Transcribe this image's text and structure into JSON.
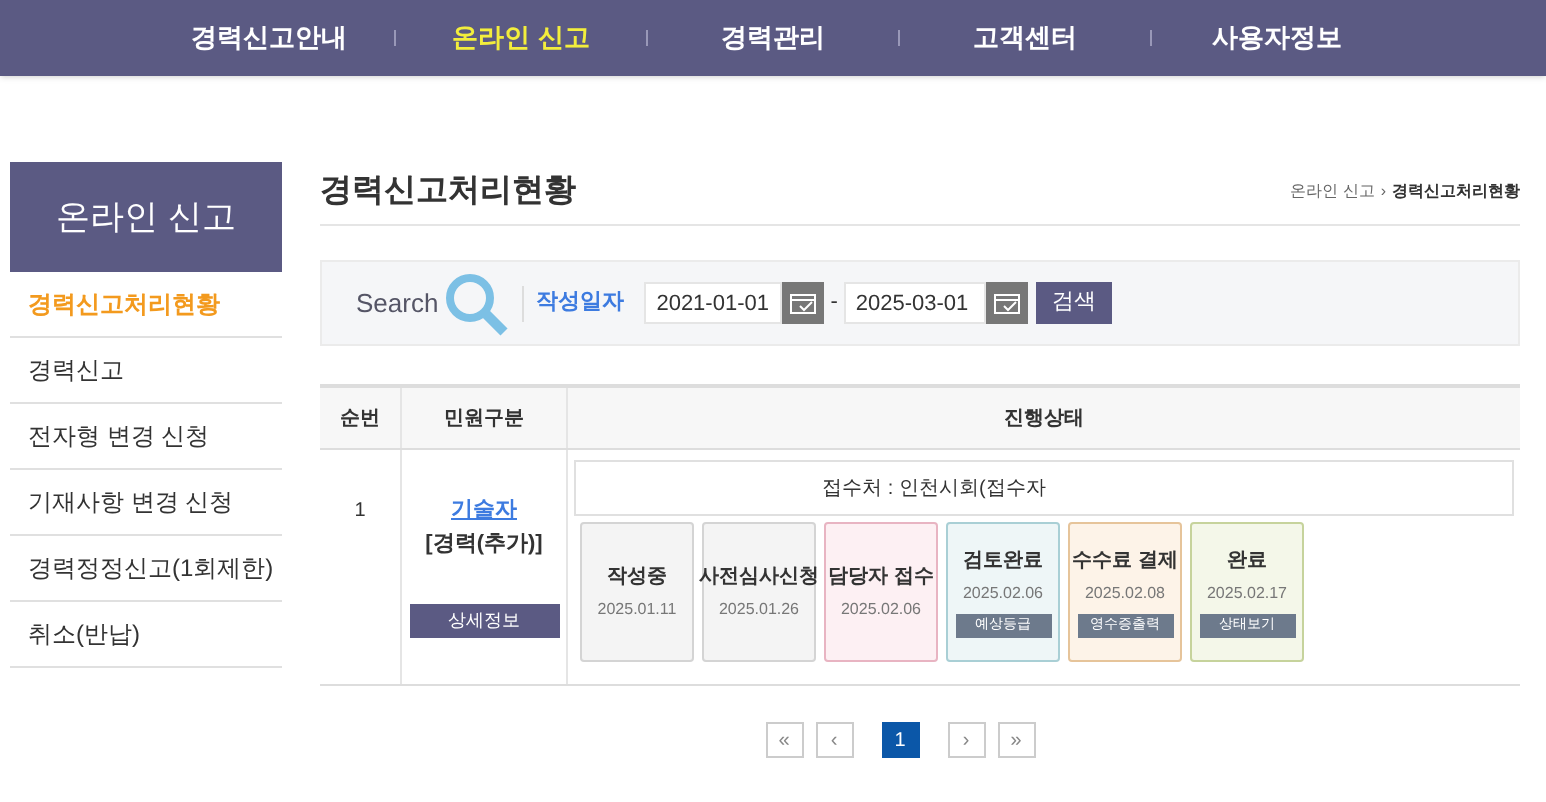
{
  "nav": [
    {
      "label": "경력신고안내",
      "selected": false
    },
    {
      "label": "온라인 신고",
      "selected": true
    },
    {
      "label": "경력관리",
      "selected": false
    },
    {
      "label": "고객센터",
      "selected": false
    },
    {
      "label": "사용자정보",
      "selected": false
    }
  ],
  "sidebar": {
    "title": "온라인 신고",
    "items": [
      {
        "label": "경력신고처리현황",
        "selected": true
      },
      {
        "label": "경력신고",
        "selected": false
      },
      {
        "label": "전자형 변경 신청",
        "selected": false
      },
      {
        "label": "기재사항 변경 신청",
        "selected": false
      },
      {
        "label": "경력정정신고(1회제한)",
        "selected": false
      },
      {
        "label": "취소(반납)",
        "selected": false
      }
    ]
  },
  "page_title": "경력신고처리현황",
  "breadcrumb": [
    "온라인 신고",
    "›",
    "경력신고처리현황"
  ],
  "search": {
    "label": "Search",
    "field_label": "작성일자",
    "from": "2021-01-01",
    "separator": "-",
    "to": "2025-03-01",
    "button": "검색"
  },
  "table": {
    "columns": [
      "순번",
      "민원구분",
      "진행상태"
    ],
    "rows": [
      {
        "number": "1",
        "type_link": "기술자",
        "type_detail": "[경력(추가)]",
        "detail_button": "상세정보",
        "office": "접수처 : 인천시회(접수자",
        "stages": [
          {
            "name": "작성중",
            "date": "2025.01.11",
            "color": "#f4f4f4"
          },
          {
            "name": "사전심사신청",
            "date": "2025.01.26",
            "color": "#f4f4f4"
          },
          {
            "name": "담당자 접수",
            "date": "2025.02.06",
            "color": "#fdf0f3"
          },
          {
            "name": "검토완료",
            "date": "2025.02.06",
            "button": "예상등급",
            "color": "#eef6f7"
          },
          {
            "name": "수수료 결제",
            "date": "2025.02.08",
            "button": "영수증출력",
            "color": "#fdf3e8"
          },
          {
            "name": "완료",
            "date": "2025.02.17",
            "button": "상태보기",
            "color": "#f4f7e9"
          }
        ]
      }
    ]
  },
  "pagination": [
    {
      "label": "«",
      "kind": "first"
    },
    {
      "label": "‹",
      "kind": "prev"
    },
    {
      "label": "1",
      "kind": "page",
      "selected": true
    },
    {
      "label": "›",
      "kind": "next"
    },
    {
      "label": "»",
      "kind": "last"
    }
  ]
}
